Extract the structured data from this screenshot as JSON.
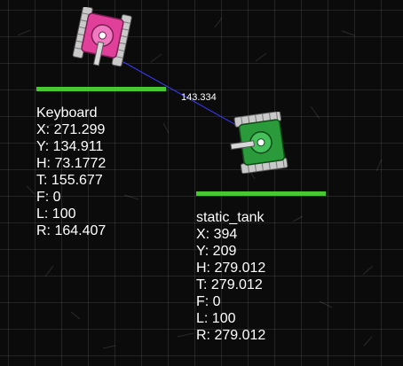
{
  "colors": {
    "background": "#0b0b0b",
    "grid": "rgba(255,255,255,0.10)",
    "health_bar": "#47c832",
    "link_line": "#3a3aff",
    "player_tank": "#e0409a",
    "enemy_tank": "#2a9a3a"
  },
  "link": {
    "distance": "143.334"
  },
  "tanks": [
    {
      "name": "Keyboard",
      "x": "X: 271.299",
      "y": "Y: 134.911",
      "h": "H: 73.1772",
      "t": "T: 155.677",
      "f": "F: 0",
      "l": "L: 100",
      "r": "R: 164.407",
      "health": 100
    },
    {
      "name": "static_tank",
      "x": "X: 394",
      "y": "Y: 209",
      "h": "H: 279.012",
      "t": "T: 279.012",
      "f": "F: 0",
      "l": "L: 100",
      "r": "R: 279.012",
      "health": 100
    }
  ]
}
